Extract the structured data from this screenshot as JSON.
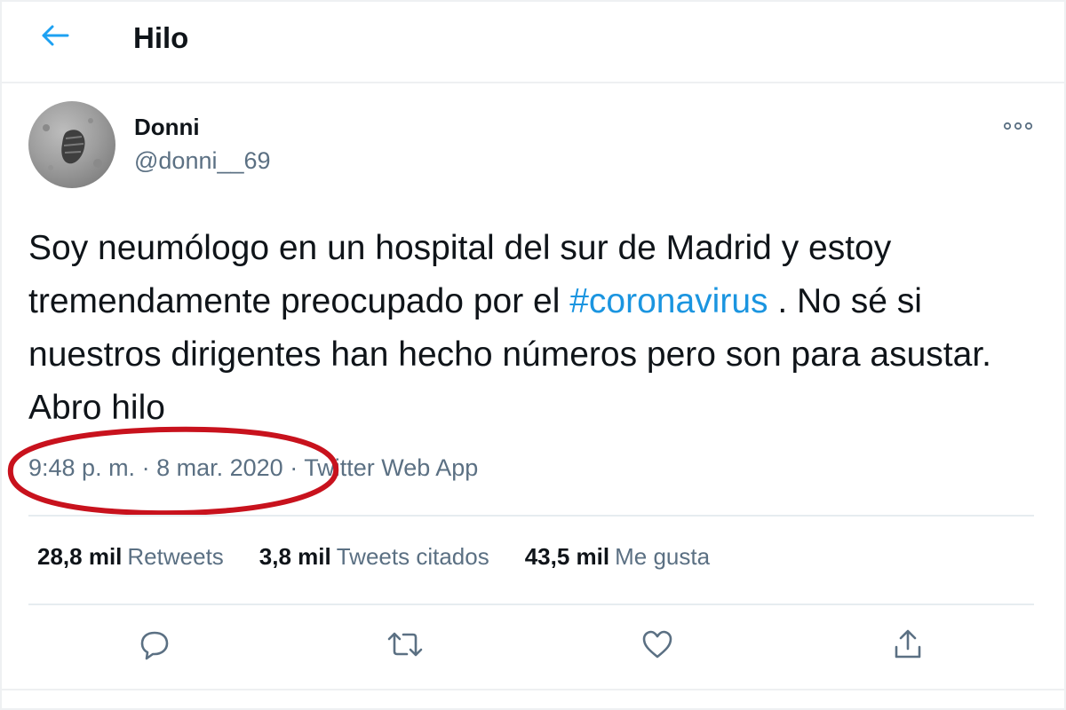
{
  "header": {
    "title": "Hilo",
    "back_icon": "arrow-left-icon"
  },
  "tweet": {
    "author": {
      "display_name": "Donni",
      "handle": "@donni__69"
    },
    "text_before": "Soy neumólogo en un hospital del sur de Madrid y estoy tremendamente preocupado por el ",
    "hashtag": "#coronavirus",
    "text_after": " . No sé si nuestros dirigentes han hecho números pero son para asustar. Abro hilo",
    "time": "9:48 p. m.",
    "date": "8 mar. 2020",
    "separator": "·",
    "source": "Twitter Web App",
    "stats": [
      {
        "value": "28,8 mil",
        "label": "Retweets"
      },
      {
        "value": "3,8 mil",
        "label": "Tweets citados"
      },
      {
        "value": "43,5 mil",
        "label": "Me gusta"
      }
    ],
    "actions": [
      "reply-icon",
      "retweet-icon",
      "like-icon",
      "share-icon"
    ]
  },
  "colors": {
    "accent": "#1da1f2",
    "hashtag": "#1b95e0",
    "secondary_text": "#5b7083",
    "annotation": "#c8121d"
  }
}
